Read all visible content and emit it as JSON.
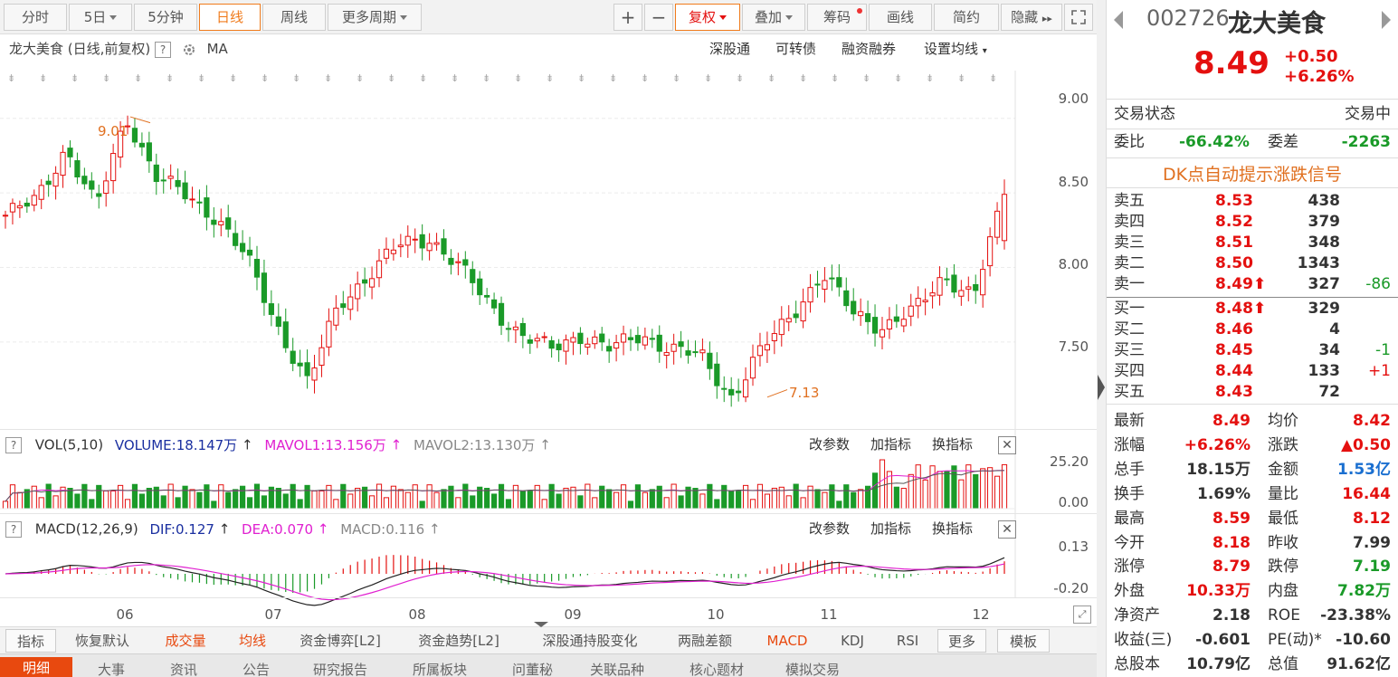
{
  "toolbar": {
    "periods": [
      "分时",
      "5日",
      "5分钟",
      "日线",
      "周线",
      "更多周期"
    ],
    "active": "日线",
    "zoom_in": "+",
    "zoom_out": "−",
    "fuquan": "复权",
    "overlay": "叠加",
    "chips": "筹码",
    "draw": "画线",
    "simple": "简约",
    "hide": "隐藏",
    "more": "▸▸"
  },
  "chart_header": {
    "title": "龙大美食 (日线,前复权)",
    "ma": "MA",
    "links": [
      "深股通",
      "可转债",
      "融资融券",
      "设置均线"
    ]
  },
  "price_axis": [
    "9.00",
    "8.50",
    "8.00",
    "7.50"
  ],
  "annotations": {
    "high": "9.01",
    "low": "7.13"
  },
  "vol_panel": {
    "label": "VOL(5,10)",
    "volume": "VOLUME:18.147万",
    "mavol1": "MAVOL1:13.156万",
    "mavol2": "MAVOL2:13.130万",
    "axis": [
      "25.20",
      "0.00"
    ],
    "links": [
      "改参数",
      "加指标",
      "换指标"
    ],
    "close": "✕"
  },
  "macd_panel": {
    "label": "MACD(12,26,9)",
    "dif": "DIF:0.127",
    "dea": "DEA:0.070",
    "macd": "MACD:0.116",
    "axis": [
      "0.13",
      "-0.20"
    ],
    "links": [
      "改参数",
      "加指标",
      "换指标"
    ],
    "close": "✕"
  },
  "months": [
    "06",
    "07",
    "08",
    "09",
    "10",
    "11",
    "12"
  ],
  "tabs": [
    "指标",
    "恢复默认",
    "成交量",
    "均线",
    "资金博弈[L2]",
    "资金趋势[L2]",
    "深股通持股变化",
    "两融差额",
    "MACD",
    "KDJ",
    "RSI",
    "更多",
    "模板"
  ],
  "tabs2": [
    "明细",
    "大事",
    "资讯",
    "公告",
    "研究报告",
    "所属板块",
    "问董秘",
    "关联品种",
    "核心题材",
    "模拟交易"
  ],
  "quote": {
    "code": "002726",
    "name": "龙大美食",
    "price": "8.49",
    "change": "+0.50",
    "change_pct": "+6.26%",
    "status_label": "交易状态",
    "status": "交易中",
    "weibi_label": "委比",
    "weibi": "-66.42%",
    "weicha_label": "委差",
    "weicha": "-2263",
    "dk_banner": "DK点自动提示涨跌信号",
    "asks": [
      {
        "label": "卖五",
        "price": "8.53",
        "vol": "438",
        "chg": ""
      },
      {
        "label": "卖四",
        "price": "8.52",
        "vol": "379",
        "chg": ""
      },
      {
        "label": "卖三",
        "price": "8.51",
        "vol": "348",
        "chg": ""
      },
      {
        "label": "卖二",
        "price": "8.50",
        "vol": "1343",
        "chg": ""
      },
      {
        "label": "卖一",
        "price": "8.49⬆",
        "vol": "327",
        "chg": "-86"
      }
    ],
    "bids": [
      {
        "label": "买一",
        "price": "8.48⬆",
        "vol": "329",
        "chg": ""
      },
      {
        "label": "买二",
        "price": "8.46",
        "vol": "4",
        "chg": ""
      },
      {
        "label": "买三",
        "price": "8.45",
        "vol": "34",
        "chg": "-1"
      },
      {
        "label": "买四",
        "price": "8.44",
        "vol": "133",
        "chg": "+1"
      },
      {
        "label": "买五",
        "price": "8.43",
        "vol": "72",
        "chg": ""
      }
    ],
    "stats": [
      {
        "l1": "最新",
        "v1": "8.49",
        "c1": "red",
        "l2": "均价",
        "v2": "8.42",
        "c2": "red"
      },
      {
        "l1": "涨幅",
        "v1": "+6.26%",
        "c1": "red",
        "l2": "涨跌",
        "v2": "▲0.50",
        "c2": "red"
      },
      {
        "l1": "总手",
        "v1": "18.15万",
        "c1": "",
        "l2": "金额",
        "v2": "1.53亿",
        "c2": "blue"
      },
      {
        "l1": "换手",
        "v1": "1.69%",
        "c1": "",
        "l2": "量比",
        "v2": "16.44",
        "c2": "red"
      },
      {
        "l1": "最高",
        "v1": "8.59",
        "c1": "red",
        "l2": "最低",
        "v2": "8.12",
        "c2": "red"
      },
      {
        "l1": "今开",
        "v1": "8.18",
        "c1": "red",
        "l2": "昨收",
        "v2": "7.99",
        "c2": ""
      },
      {
        "l1": "涨停",
        "v1": "8.79",
        "c1": "red",
        "l2": "跌停",
        "v2": "7.19",
        "c2": "green"
      },
      {
        "l1": "外盘",
        "v1": "10.33万",
        "c1": "red",
        "l2": "内盘",
        "v2": "7.82万",
        "c2": "green"
      },
      {
        "l1": "净资产",
        "v1": "2.18",
        "c1": "",
        "l2": "ROE",
        "v2": "-23.38%",
        "c2": ""
      },
      {
        "l1": "收益(三)",
        "v1": "-0.601",
        "c1": "",
        "l2": "PE(动)*",
        "v2": "-10.60",
        "c2": ""
      },
      {
        "l1": "总股本",
        "v1": "10.79亿",
        "c1": "",
        "l2": "总值",
        "v2": "91.62亿",
        "c2": ""
      }
    ]
  },
  "colors": {
    "up": "#e4100f",
    "down": "#1a9a28",
    "accent": "#f07b1c"
  },
  "chart_data": {
    "type": "candlestick",
    "price_ylim": [
      7.05,
      9.15
    ],
    "months": [
      "06",
      "07",
      "08",
      "09",
      "10",
      "11",
      "12"
    ],
    "keypoints": [
      [
        8.35,
        "05-20"
      ],
      [
        8.45,
        "05-28"
      ],
      [
        8.8,
        "06-01"
      ],
      [
        8.4,
        "06-05"
      ],
      [
        9.01,
        "06-08"
      ],
      [
        8.6,
        "06-12"
      ],
      [
        8.48,
        "06-20"
      ],
      [
        8.33,
        "07-01"
      ],
      [
        8.05,
        "07-10"
      ],
      [
        7.6,
        "07-15"
      ],
      [
        7.22,
        "07-16"
      ],
      [
        7.75,
        "07-22"
      ],
      [
        7.95,
        "07-28"
      ],
      [
        8.15,
        "08-01"
      ],
      [
        8.2,
        "08-04"
      ],
      [
        8.0,
        "08-12"
      ],
      [
        7.75,
        "08-20"
      ],
      [
        7.55,
        "08-27"
      ],
      [
        7.45,
        "09-05"
      ],
      [
        7.55,
        "09-12"
      ],
      [
        7.45,
        "09-20"
      ],
      [
        7.55,
        "09-28"
      ],
      [
        7.45,
        "10-10"
      ],
      [
        7.4,
        "10-18"
      ],
      [
        7.13,
        "10-22"
      ],
      [
        7.45,
        "10-28"
      ],
      [
        7.7,
        "11-04"
      ],
      [
        7.95,
        "11-08"
      ],
      [
        7.7,
        "11-14"
      ],
      [
        7.6,
        "11-22"
      ],
      [
        7.7,
        "12-01"
      ],
      [
        7.95,
        "12-06"
      ],
      [
        7.8,
        "12-10"
      ],
      [
        8.49,
        "12-12"
      ]
    ]
  }
}
